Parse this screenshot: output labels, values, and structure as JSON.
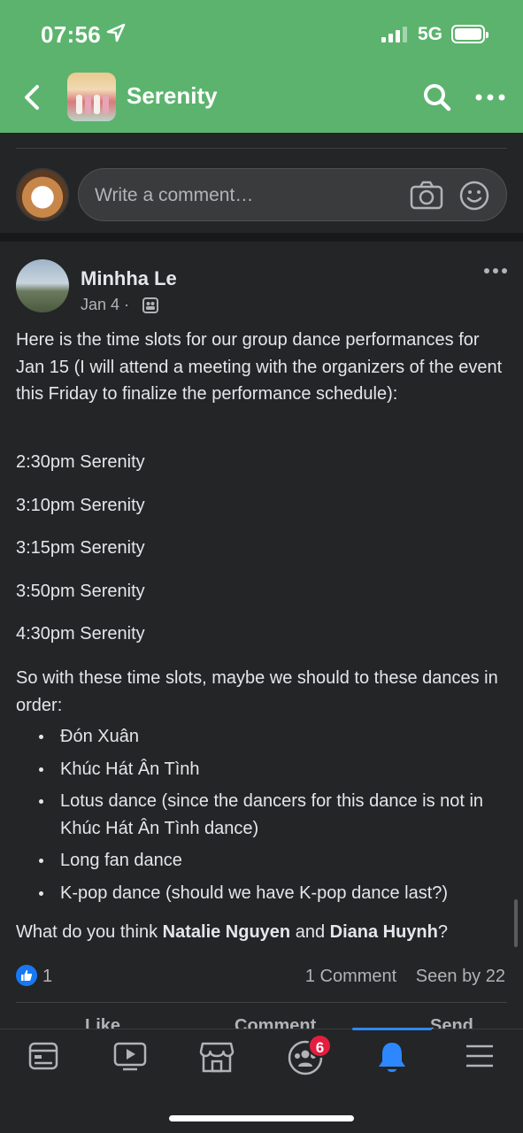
{
  "status_bar": {
    "time": "07:56",
    "network": "5G"
  },
  "header": {
    "title": "Serenity"
  },
  "comment_composer": {
    "placeholder": "Write a comment…"
  },
  "post": {
    "author": "Minhha Le",
    "date": "Jan 4 ·",
    "intro": "Here is the time slots for our group dance performances for Jan 15 (I will attend a meeting with the organizers of the event this Friday to finalize the performance schedule):",
    "time_slots": [
      "2:30pm Serenity",
      "3:10pm Serenity",
      "3:15pm Serenity",
      "3:50pm Serenity",
      "4:30pm Serenity"
    ],
    "order_intro": "So with these time slots, maybe we should to these dances in order:",
    "dances": [
      "Đón Xuân",
      "Khúc Hát Ân Tình",
      "Lotus dance (since the dancers for this dance is not in Khúc Hát Ân Tình dance)",
      "Long fan dance",
      "K-pop dance (should we have K-pop dance last?)"
    ],
    "question_prefix": "What do you think ",
    "mention_1": "Natalie Nguyen",
    "question_and": " and ",
    "mention_2": "Diana Huynh",
    "question_suffix": "?",
    "like_count": "1",
    "comments": "1 Comment",
    "seen_by": "Seen by 22",
    "actions": {
      "like": "Like",
      "comment": "Comment",
      "send": "Send"
    }
  },
  "tabbar": {
    "items": [
      "feed-icon",
      "video-icon",
      "marketplace-icon",
      "groups-icon",
      "notifications-icon",
      "menu-icon"
    ],
    "groups_badge": "6",
    "active": "notifications-icon",
    "active_color": "#2d88ff"
  },
  "colors": {
    "header": "#5cb36e",
    "background": "#242526",
    "like_blue": "#1877f2",
    "badge_red": "#e41e3f"
  }
}
